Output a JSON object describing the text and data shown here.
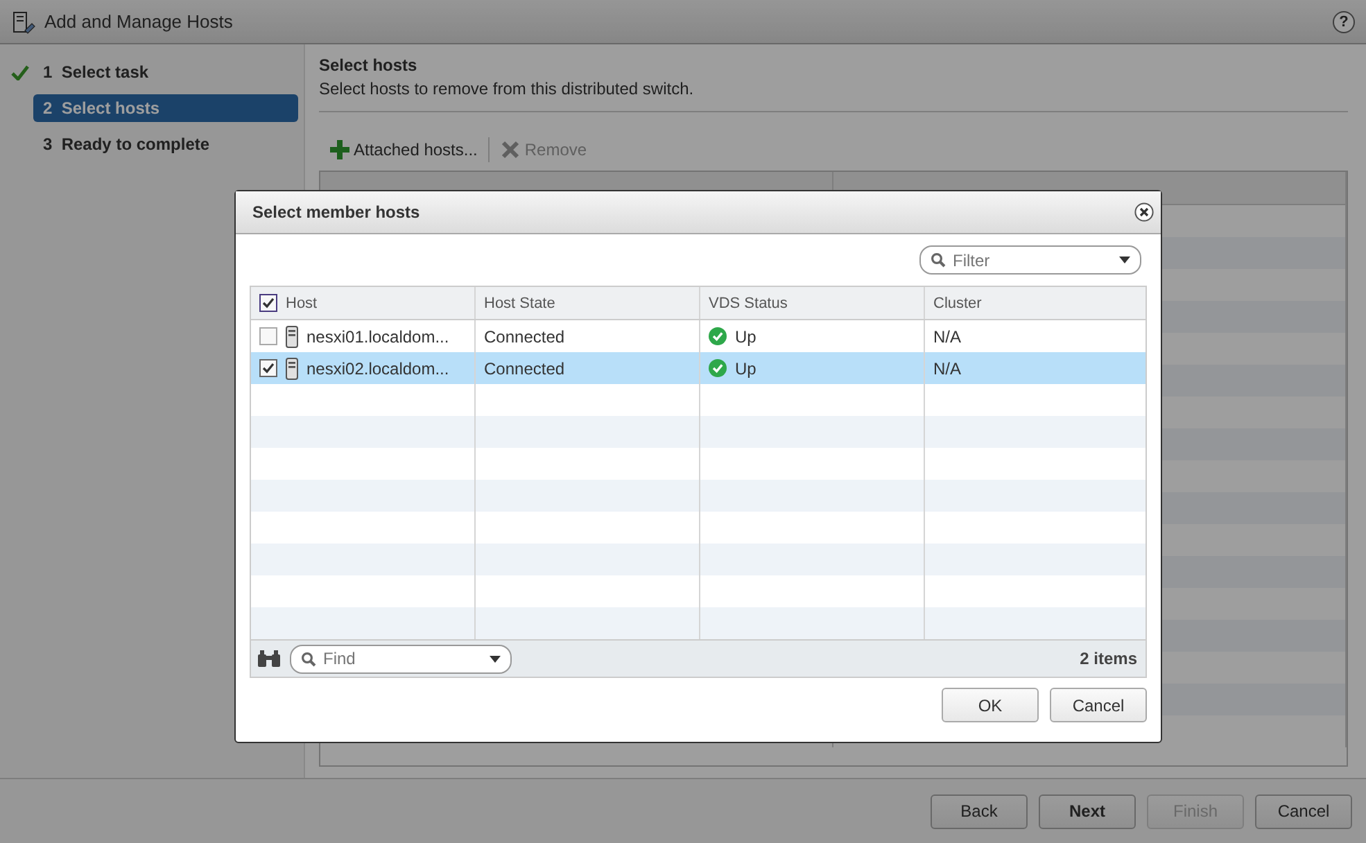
{
  "window": {
    "title": "Add and Manage Hosts",
    "help": "?"
  },
  "steps": [
    {
      "number": "1",
      "label": "Select task",
      "completed": true,
      "selected": false
    },
    {
      "number": "2",
      "label": "Select hosts",
      "completed": false,
      "selected": true
    },
    {
      "number": "3",
      "label": "Ready to complete",
      "completed": false,
      "selected": false
    }
  ],
  "page": {
    "title": "Select hosts",
    "description": "Select hosts to remove from this distributed switch."
  },
  "toolbar": [
    {
      "label": "Attached hosts...",
      "kind": "add",
      "disabled": false
    },
    {
      "label": "Remove",
      "kind": "remove",
      "disabled": true
    }
  ],
  "footer_buttons": [
    {
      "label": "Back",
      "primary": false,
      "disabled": false
    },
    {
      "label": "Next",
      "primary": true,
      "disabled": false
    },
    {
      "label": "Finish",
      "primary": false,
      "disabled": true
    },
    {
      "label": "Cancel",
      "primary": false,
      "disabled": false
    }
  ],
  "dialog": {
    "title": "Select member hosts",
    "filter": {
      "placeholder": "Filter"
    },
    "columns": [
      "Host",
      "Host State",
      "VDS Status",
      "Cluster"
    ],
    "select_all_checked": true,
    "rows": [
      {
        "host": "nesxi01.localdom...",
        "host_state": "Connected",
        "vds_status": "Up",
        "cluster": "N/A",
        "checked": false,
        "selected": false
      },
      {
        "host": "nesxi02.localdom...",
        "host_state": "Connected",
        "vds_status": "Up",
        "cluster": "N/A",
        "checked": true,
        "selected": true
      }
    ],
    "find": {
      "placeholder": "Find"
    },
    "count": "2 items",
    "buttons": [
      "OK",
      "Cancel"
    ]
  }
}
